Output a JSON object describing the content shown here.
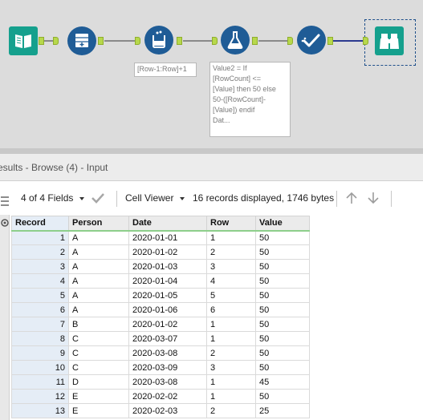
{
  "canvas": {
    "annotations": {
      "multirow_formula": "[Row-1:Row]+1",
      "formula": "Value2 = If\n[RowCount] <=\n[Value] then 50 else\n50-([RowCount]-\n[Value]) endif\nDat..."
    },
    "colors": {
      "background": "#dcdcdc",
      "tool_blue": "#1f5c96",
      "tool_teal": "#15a08d",
      "anchor_green": "#b7d84b",
      "connection_blue": "#2b3a8f"
    }
  },
  "results": {
    "title": "esults - Browse (4) - Input",
    "fields_label": "4 of 4 Fields",
    "viewer_label": "Cell Viewer",
    "status": "16 records displayed, 1746 bytes"
  },
  "table": {
    "headers": [
      "Record",
      "Person",
      "Date",
      "Row",
      "Value"
    ],
    "rows": [
      [
        "1",
        "A",
        "2020-01-01",
        "1",
        "50"
      ],
      [
        "2",
        "A",
        "2020-01-02",
        "2",
        "50"
      ],
      [
        "3",
        "A",
        "2020-01-03",
        "3",
        "50"
      ],
      [
        "4",
        "A",
        "2020-01-04",
        "4",
        "50"
      ],
      [
        "5",
        "A",
        "2020-01-05",
        "5",
        "50"
      ],
      [
        "6",
        "A",
        "2020-01-06",
        "6",
        "50"
      ],
      [
        "7",
        "B",
        "2020-01-02",
        "1",
        "50"
      ],
      [
        "8",
        "C",
        "2020-03-07",
        "1",
        "50"
      ],
      [
        "9",
        "C",
        "2020-03-08",
        "2",
        "50"
      ],
      [
        "10",
        "C",
        "2020-03-09",
        "3",
        "50"
      ],
      [
        "11",
        "D",
        "2020-03-08",
        "1",
        "45"
      ],
      [
        "12",
        "E",
        "2020-02-02",
        "1",
        "50"
      ],
      [
        "13",
        "E",
        "2020-02-03",
        "2",
        "25"
      ]
    ]
  }
}
